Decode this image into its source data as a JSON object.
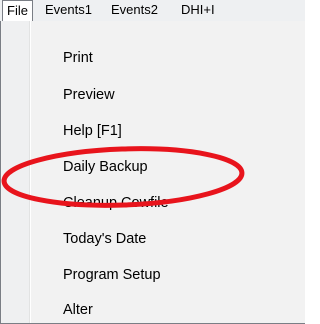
{
  "menubar": {
    "items": [
      {
        "label": "File"
      },
      {
        "label": "Events1"
      },
      {
        "label": "Events2"
      },
      {
        "label": "DHI+I"
      }
    ]
  },
  "file_menu": {
    "items": [
      {
        "label": "Print"
      },
      {
        "label": "Preview"
      },
      {
        "label": "Help [F1]"
      },
      {
        "label": "Daily Backup"
      },
      {
        "label": "Cleanup Cowfile"
      },
      {
        "label": "Today's Date"
      },
      {
        "label": "Program Setup"
      },
      {
        "label": "Alter"
      }
    ]
  },
  "annotation": {
    "color": "#e8141c",
    "target": "Daily Backup"
  }
}
